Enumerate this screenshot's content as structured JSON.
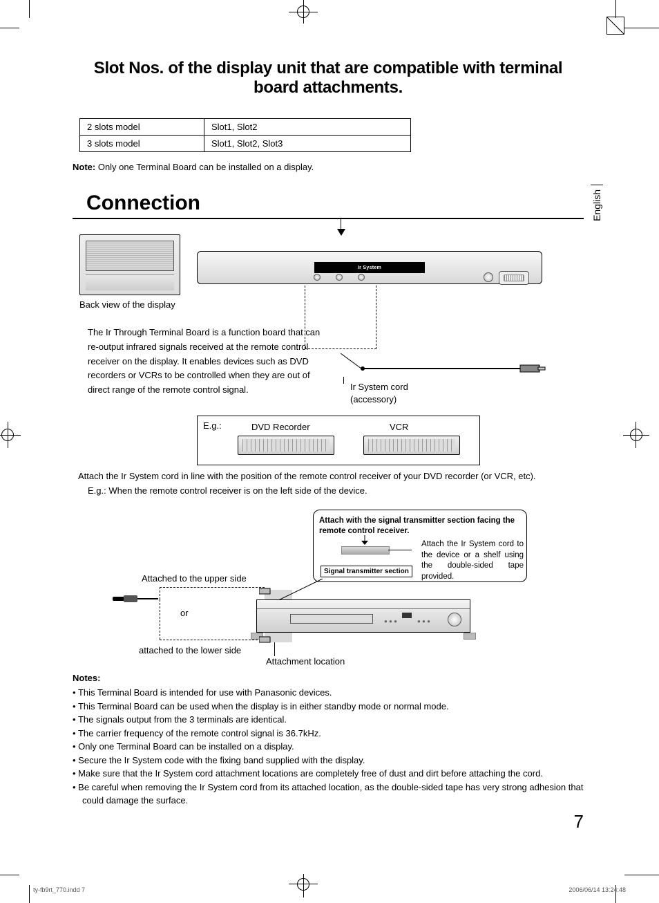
{
  "title": "Slot Nos. of the display unit that are compatible with terminal board attachments.",
  "table": {
    "r1c1": "2 slots model",
    "r1c2": "Slot1, Slot2",
    "r2c1": "3 slots model",
    "r2c2": "Slot1, Slot2, Slot3"
  },
  "note_label": "Note:",
  "note_text": " Only one Terminal Board can be installed on a display.",
  "section_heading": "Connection",
  "language_tab": "English",
  "diagram": {
    "back_view_caption": "Back view of the display",
    "ir_system_badge": "Ir System",
    "description": "The Ir Through Terminal Board is a function board that can re-output infrared signals received at the remote control receiver on the display. It enables devices such as DVD recorders or VCRs to be controlled when they are out of direct range of the remote control signal.",
    "cord_label_1": "Ir System cord",
    "cord_label_2": "(accessory)",
    "eg_label": "E.g.:",
    "device1": "DVD Recorder",
    "device2": "VCR"
  },
  "attach": {
    "line1": "Attach the Ir System cord in line with the position of the remote control receiver of your DVD recorder (or VCR, etc).",
    "line2": "E.g.: When the remote control receiver is on the left side of the device.",
    "callout_head": "Attach with the signal transmitter section facing the remote control receiver.",
    "sig_label": "Signal transmitter section",
    "side_note": "Attach the Ir System cord to the device or a shelf using the double-sided tape provided.",
    "upper": "Attached to the upper side",
    "or": "or",
    "lower": "attached to the lower side",
    "location": "Attachment location"
  },
  "notes_head": "Notes:",
  "notes": [
    "This Terminal Board is intended for use with Panasonic devices.",
    "This Terminal Board can be used when the display is in either standby mode or normal mode.",
    "The signals output from the 3 terminals are identical.",
    "The carrier frequency of the remote control signal is 36.7kHz.",
    "Only one Terminal Board can be installed on a display.",
    "Secure the Ir System code with the fixing band supplied with the display.",
    "Make sure that the Ir System cord attachment locations are completely free of dust and dirt before attaching the cord.",
    "Be careful when removing the Ir System cord from its attached location, as the double-sided tape has very strong adhesion that could damage the surface."
  ],
  "page_number": "7",
  "footer_left": "ty-fb9rt_770.indd   7",
  "footer_right": "2006/06/14   13:24:48"
}
